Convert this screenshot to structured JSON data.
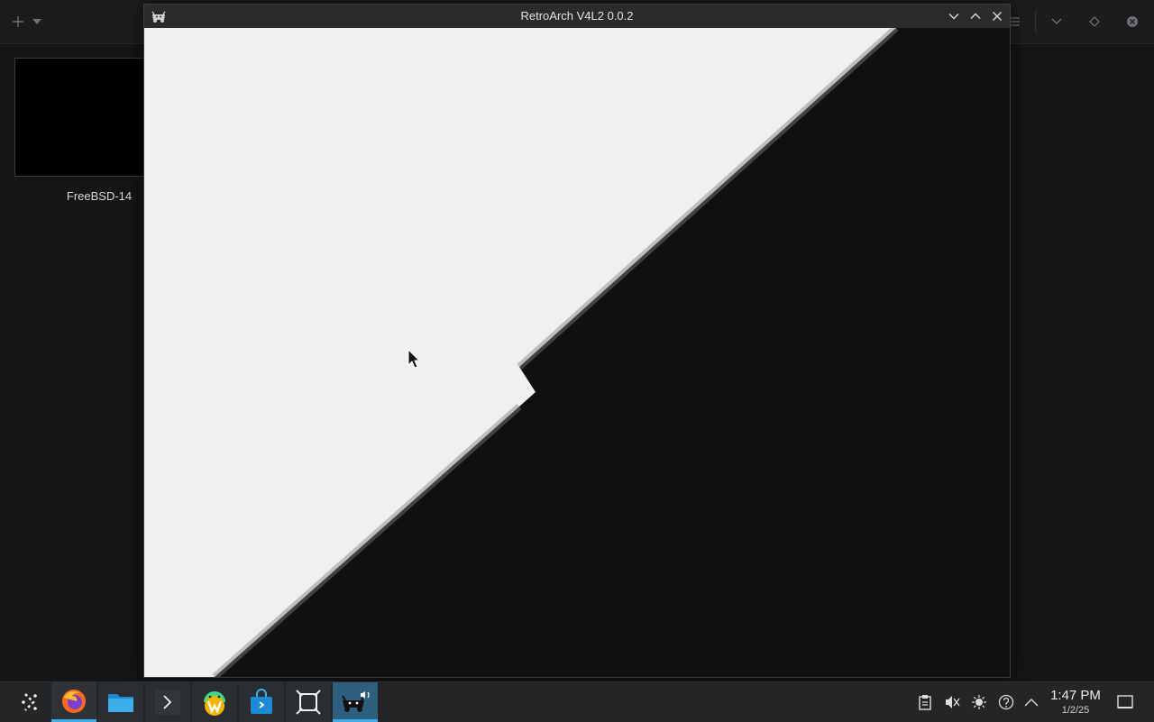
{
  "background_app": {
    "vm_name": "FreeBSD-14",
    "toolbar_icons": [
      "plus-icon",
      "dropdown-arrow-icon",
      "menu-icon",
      "chevron-down-icon",
      "diamond-icon",
      "close-circle-icon"
    ]
  },
  "window": {
    "title": "RetroArch V4L2 0.0.2",
    "controls": [
      "minimize",
      "maximize",
      "close"
    ],
    "content": {
      "description_colors": {
        "light": "#f0f0f0",
        "dark": "#101010"
      }
    }
  },
  "taskbar": {
    "launcher_icon": "application-launcher-icon",
    "apps": [
      {
        "name": "firefox-icon",
        "state": "active"
      },
      {
        "name": "files-icon",
        "state": "running"
      },
      {
        "name": "terminal-icon",
        "state": "running"
      },
      {
        "name": "android-app-icon",
        "state": "running"
      },
      {
        "name": "store-icon",
        "state": "running"
      },
      {
        "name": "window-capture-icon",
        "state": "running"
      },
      {
        "name": "retroarch-icon",
        "state": "current"
      }
    ],
    "tray_icons": [
      "clipboard-icon",
      "volume-muted-icon",
      "brightness-icon",
      "help-icon",
      "show-hidden-icon"
    ],
    "clock": {
      "time": "1:47 PM",
      "date": "1/2/25"
    },
    "show_desktop_icon": "show-desktop-icon"
  },
  "colors": {
    "accent": "#3daee9"
  }
}
